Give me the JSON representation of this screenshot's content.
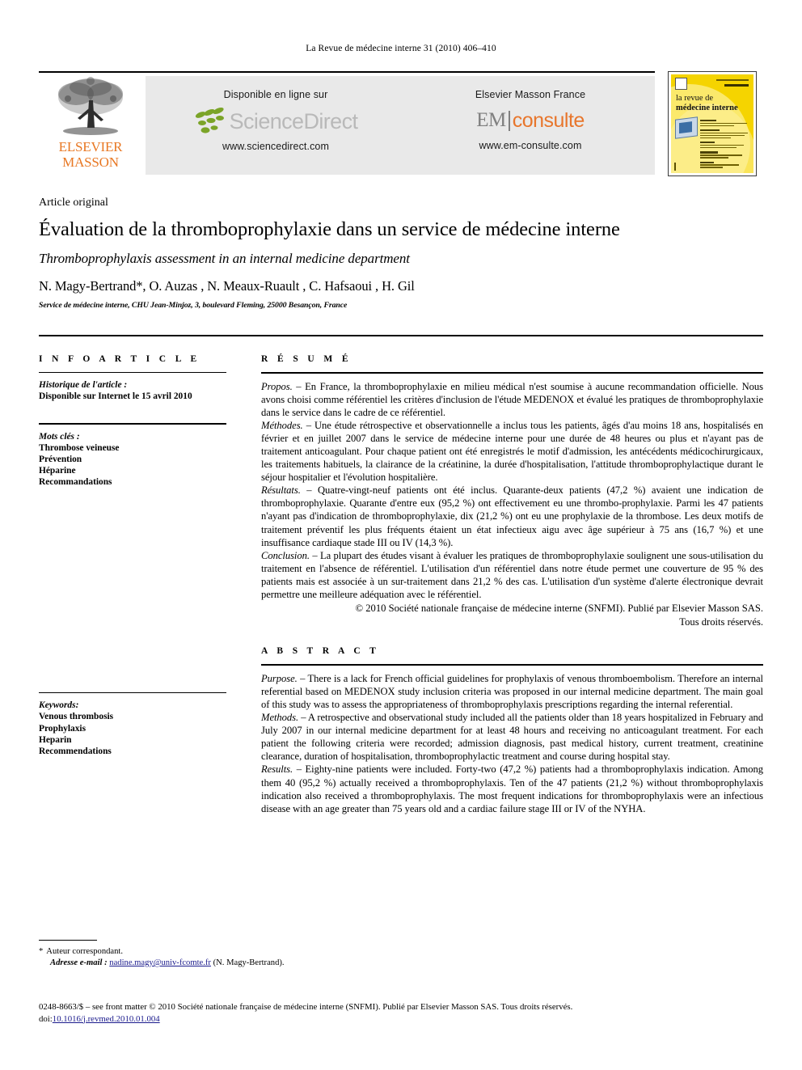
{
  "running_head": "La Revue de médecine interne 31 (2010) 406–410",
  "masthead": {
    "elsevier_logo_line1": "ELSEVIER",
    "elsevier_logo_line2": "MASSON",
    "sciencedirect": {
      "caption": "Disponible en ligne sur",
      "wordmark": "ScienceDirect",
      "url": "www.sciencedirect.com"
    },
    "emconsulte": {
      "caption": "Elsevier Masson France",
      "wordmark_left": "EM",
      "wordmark_right": "consulte",
      "url": "www.em-consulte.com"
    },
    "journal_cover": {
      "title_line1": "la revue de",
      "title_line2": "médecine interne"
    }
  },
  "title_block": {
    "article_type": "Article original",
    "title_fr": "Évaluation de la thromboprophylaxie dans un service de médecine interne",
    "title_en": "Thromboprophylaxis assessment in an internal medicine department",
    "authors": "N. Magy-Bertrand*, O. Auzas , N. Meaux-Ruault , C. Hafsaoui , H. Gil",
    "affiliation": "Service de médecine interne, CHU Jean-Minjoz, 3, boulevard Fleming, 25000 Besançon, France"
  },
  "info_article": {
    "heading": "I N F O   A R T I C L E",
    "history_label": "Historique de l'article :",
    "history_value": "Disponible sur Internet le 15 avril 2010",
    "keywords_label": "Mots clés :",
    "keywords": [
      "Thrombose veineuse",
      "Prévention",
      "Héparine",
      "Recommandations"
    ]
  },
  "keywords_en": {
    "label": "Keywords:",
    "items": [
      "Venous thrombosis",
      "Prophylaxis",
      "Heparin",
      "Recommendations"
    ]
  },
  "resume": {
    "heading": "R É S U M É",
    "paragraphs": [
      {
        "lead": "Propos.",
        "dash": " – ",
        "text": "En France, la thromboprophylaxie en milieu médical n'est soumise à aucune recommandation officielle. Nous avons choisi comme référentiel les critères d'inclusion de l'étude MEDENOX et évalué les pratiques de thromboprophylaxie dans le service dans le cadre de ce référentiel."
      },
      {
        "lead": "Méthodes.",
        "dash": " – ",
        "text": "Une étude rétrospective et observationnelle a inclus tous les patients, âgés d'au moins 18 ans, hospitalisés en février et en juillet 2007 dans le service de médecine interne pour une durée de 48 heures ou plus et n'ayant pas de traitement anticoagulant. Pour chaque patient ont été enregistrés le motif d'admission, les antécédents médicochirurgicaux, les traitements habituels, la clairance de la créatinine, la durée d'hospitalisation, l'attitude thromboprophylactique durant le séjour hospitalier et l'évolution hospitalière."
      },
      {
        "lead": "Résultats.",
        "dash": " – ",
        "text": "Quatre-vingt-neuf patients ont été inclus. Quarante-deux patients (47,2 %) avaient une indication de thromboprophylaxie. Quarante d'entre eux (95,2 %) ont effectivement eu une thrombo-prophylaxie. Parmi les 47 patients n'ayant pas d'indication de thromboprophylaxie, dix (21,2 %) ont eu une prophylaxie de la thrombose. Les deux motifs de traitement préventif les plus fréquents étaient un état infectieux aigu avec âge supérieur à 75 ans (16,7 %) et une insuffisance cardiaque stade III ou IV (14,3 %)."
      },
      {
        "lead": "Conclusion.",
        "dash": " – ",
        "text": "La plupart des études visant à évaluer les pratiques de thromboprophylaxie soulignent une sous-utilisation du traitement en l'absence de référentiel. L'utilisation d'un référentiel dans notre étude permet une couverture de 95 % des patients mais est associée à un sur-traitement dans 21,2 % des cas. L'utilisation d'un système d'alerte électronique devrait permettre une meilleure adéquation avec le référentiel."
      }
    ],
    "copyright_line1": "© 2010 Société nationale française de médecine interne (SNFMI). Publié par Elsevier Masson SAS.",
    "copyright_line2": "Tous droits réservés."
  },
  "abstract": {
    "heading": "A B S T R A C T",
    "paragraphs": [
      {
        "lead": "Purpose.",
        "dash": " – ",
        "text": "There is a lack for French official guidelines for prophylaxis of venous thromboembolism. Therefore an internal referential based on MEDENOX study inclusion criteria was proposed in our internal medicine department. The main goal of this study was to assess the appropriateness of thromboprophylaxis prescriptions regarding the internal referential."
      },
      {
        "lead": "Methods.",
        "dash": " – ",
        "text": "A retrospective and observational study included all the patients older than 18 years hospitalized in February and July 2007 in our internal medicine department for at least 48 hours and receiving no anticoagulant treatment. For each patient the following criteria were recorded; admission diagnosis, past medical history, current treatment, creatinine clearance, duration of hospitalisation, thromboprophylactic treatment and course during hospital stay."
      },
      {
        "lead": "Results.",
        "dash": " – ",
        "text": "Eighty-nine patients were included. Forty-two (47,2 %) patients had a thromboprophylaxis indication. Among them 40 (95,2 %) actually received a thromboprophylaxis. Ten of the 47 patients (21,2 %) without thromboprophylaxis indication also received a thromboprophylaxis. The most frequent indications for thromboprophylaxis were an infectious disease with an age greater than 75 years old and a cardiac failure stage III or IV of the NYHA."
      }
    ]
  },
  "footnote": {
    "star": "*",
    "corresponding": "Auteur correspondant.",
    "email_label": "Adresse e-mail :",
    "email": "nadine.magy@univ-fcomte.fr",
    "email_suffix": "(N. Magy-Bertrand)."
  },
  "footer": {
    "issn_line": "0248-8663/$ – see front matter © 2010 Société nationale française de médecine interne (SNFMI). Publié par Elsevier Masson SAS. Tous droits réservés.",
    "doi_label": "doi:",
    "doi_value": "10.1016/j.revmed.2010.01.004"
  },
  "colors": {
    "elsevier_orange": "#E87722",
    "emconsulte_orange": "#E8762C",
    "banner_gray": "#e9e9e9",
    "sciencedirect_gray": "#b9b9b9",
    "cover_yellow": "#F5D400",
    "link_blue": "#1a1a8c"
  }
}
